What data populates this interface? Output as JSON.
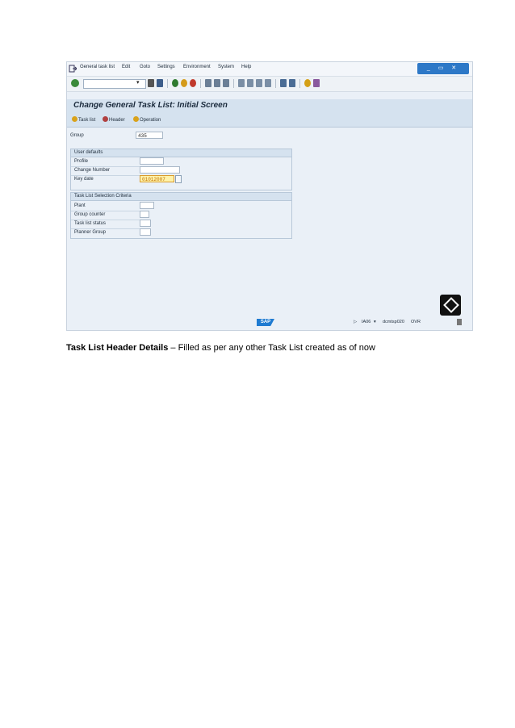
{
  "menu": {
    "items": [
      "General task list",
      "Edit",
      "Goto",
      "Settings",
      "Environment",
      "System",
      "Help"
    ],
    "window_controls": "_ ▭ ✕"
  },
  "screen": {
    "title": "Change General Task List: Initial Screen",
    "app_toolbar": [
      "Task list",
      "Header",
      "Operation"
    ]
  },
  "fields": {
    "group_label": "Group",
    "group_value": "435",
    "user_defaults": {
      "heading": "User defaults",
      "profile_label": "Profile",
      "profile_value": "",
      "change_number_label": "Change Number",
      "change_number_value": "",
      "key_date_label": "Key date",
      "key_date_value": "01012007"
    },
    "selection": {
      "heading": "Task List Selection Criteria",
      "plant_label": "Plant",
      "group_counter_label": "Group counter",
      "task_list_status_label": "Task list status",
      "planner_group_label": "Planner Group"
    }
  },
  "statusbar": {
    "logo": "SAP",
    "system": "IA06",
    "server": "dcmtsp020",
    "mode": "OVR"
  },
  "caption": {
    "bold": "Task List Header Details",
    "rest": " – Filled as per any other Task List created as of now"
  }
}
